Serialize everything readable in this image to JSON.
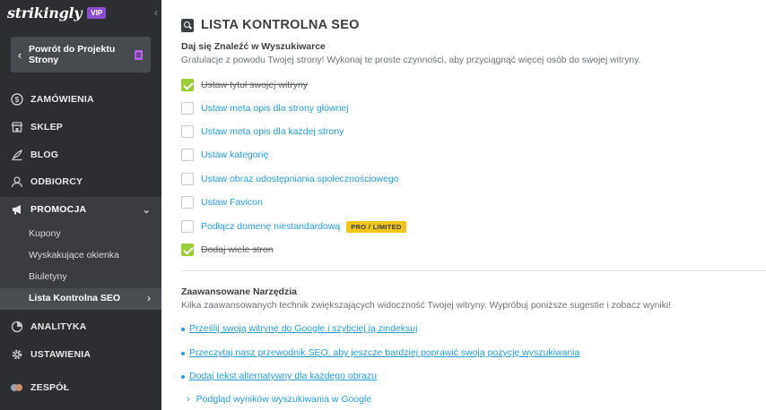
{
  "sidebar": {
    "logo": "strikingly",
    "vip_badge": "VIP",
    "back_button": "Powrót do Projektu Strony",
    "nav": [
      {
        "label": "ZAMÓWIENIA",
        "icon": "dollar-circle-icon"
      },
      {
        "label": "SKLEP",
        "icon": "store-icon"
      },
      {
        "label": "BLOG",
        "icon": "quill-pen-icon"
      },
      {
        "label": "ODBIORCY",
        "icon": "users-icon"
      },
      {
        "label": "PROMOCJA",
        "icon": "megaphone-icon"
      },
      {
        "label": "ANALITYKA",
        "icon": "pie-chart-icon"
      },
      {
        "label": "USTAWIENIA",
        "icon": "gear-icon"
      },
      {
        "label": "ZESPÓŁ",
        "icon": "team-avatars-icon"
      }
    ],
    "promo_sub": [
      {
        "label": "Kupony"
      },
      {
        "label": "Wyskakujące okienka"
      },
      {
        "label": "Biuletyny"
      },
      {
        "label": "Lista Kontrolna SEO"
      }
    ]
  },
  "main": {
    "title": "LISTA KONTROLNA SEO",
    "section1_title": "Daj się Znaleźć w Wyszukiwarce",
    "section1_desc": "Gratulacje z powodu Twojej strony! Wykonaj te proste czynności, aby przyciągnąć więcej osób do swojej witryny.",
    "tasks": [
      {
        "label": "Ustaw tytuł swojej witryny",
        "done": true
      },
      {
        "label": "Ustaw meta opis dla strony głównej",
        "done": false
      },
      {
        "label": "Ustaw meta opis dla każdej strony",
        "done": false
      },
      {
        "label": "Ustaw kategorię",
        "done": false
      },
      {
        "label": "Ustaw obraz udostępniania społecznościowego",
        "done": false
      },
      {
        "label": "Ustaw Favicon",
        "done": false
      },
      {
        "label": "Podłącz domenę niestandardową",
        "done": false,
        "badge": "PRO / LIMITED"
      },
      {
        "label": "Dodaj wiele stron",
        "done": true
      }
    ],
    "section2_title": "Zaawansowane Narzędzia",
    "section2_desc": "Kilka zaawansowanych technik zwiększających widoczność Twojej witryny. Wypróbuj poniższe sugestie i zobacz wyniki!",
    "links": [
      {
        "label": "Prześlij swoją witrynę do Google i szybciej ją zindeksuj"
      },
      {
        "label": "Przeczytaj nasz przewodnik SEO, aby jeszcze bardziej poprawić swoją pozycję wyszukiwania"
      },
      {
        "label": "Dodaj tekst alternatywny dla każdego obrazu"
      }
    ],
    "preview_label": "Podgląd wyników wyszukiwania w Google"
  },
  "colors": {
    "sidebar_bg": "#2c2e31",
    "accent_link": "#2a9bd6",
    "check_green": "#9ccb3c",
    "vip_purple": "#8a4ecf",
    "badge_yellow": "#f2c51d"
  }
}
